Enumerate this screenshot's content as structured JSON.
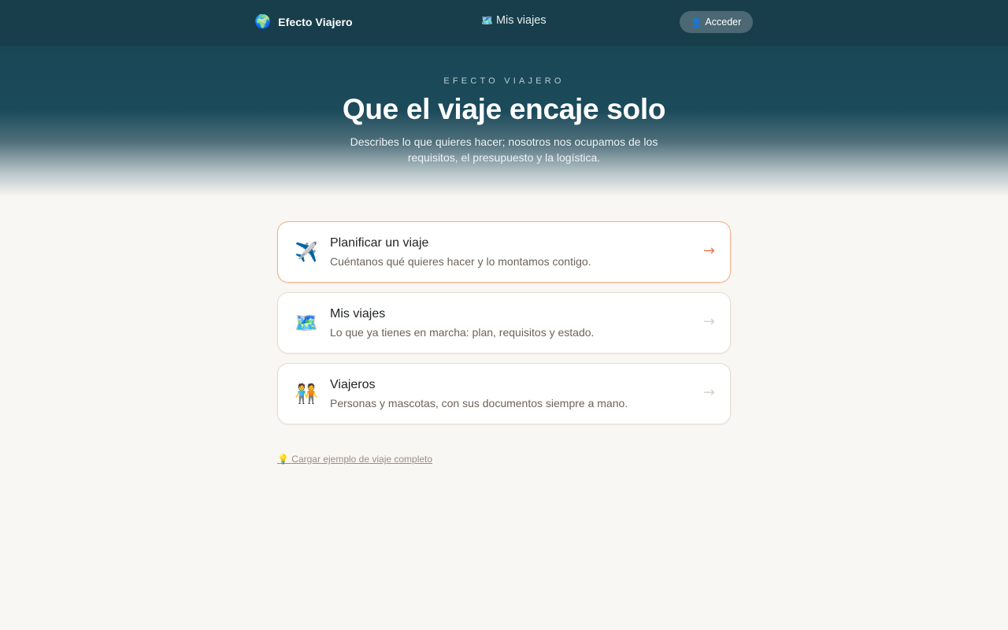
{
  "header": {
    "brand_icon": "globe-icon",
    "brand_glyph": "🌍",
    "brand_name": "Efecto Viajero",
    "nav_trips_glyph": "🗺️",
    "nav_trips_label": "Mis viajes",
    "login_glyph": "👤",
    "login_label": "Acceder"
  },
  "hero": {
    "eyebrow": "EFECTO VIAJERO",
    "title": "Que el viaje encaje solo",
    "subtitle": "Describes lo que quieres hacer; nosotros nos ocupamos de los requisitos, el presupuesto y la logística."
  },
  "cards": [
    {
      "icon": "airplane-icon",
      "glyph": "✈️",
      "title": "Planificar un viaje",
      "description": "Cuéntanos qué quieres hacer y lo montamos contigo.",
      "arrow": "→"
    },
    {
      "icon": "map-icon",
      "glyph": "🗺️",
      "title": "Mis viajes",
      "description": "Lo que ya tienes en marcha: plan, requisitos y estado.",
      "arrow": "→"
    },
    {
      "icon": "people-icon",
      "glyph": "🧑‍🤝‍🧑",
      "title": "Viajeros",
      "description": "Personas y mascotas, con sus documentos siempre a mano.",
      "arrow": "→"
    }
  ],
  "sample": {
    "glyph": "💡",
    "label": "Cargar ejemplo de viaje completo"
  },
  "colors": {
    "header_bg": "#183e4b",
    "accent": "#ec7a51",
    "page_bg": "#f9f7f3"
  }
}
